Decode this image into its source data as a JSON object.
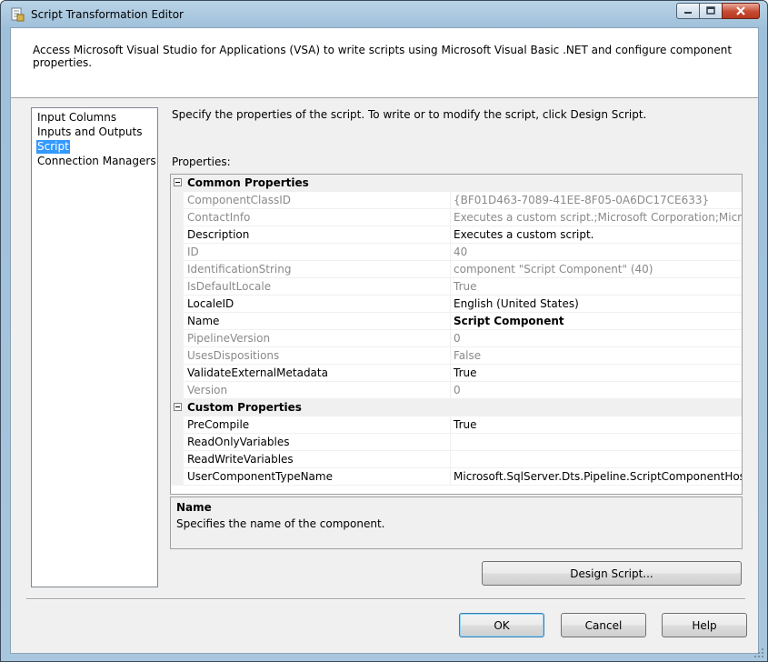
{
  "window": {
    "title": "Script Transformation Editor",
    "icon": "script-editor-icon"
  },
  "header": {
    "description": "Access Microsoft Visual Studio for Applications (VSA) to write scripts using Microsoft Visual Basic .NET and configure component properties."
  },
  "nav": {
    "items": [
      {
        "label": "Input Columns",
        "selected": false
      },
      {
        "label": "Inputs and Outputs",
        "selected": false
      },
      {
        "label": "Script",
        "selected": true
      },
      {
        "label": "Connection Managers",
        "selected": false
      }
    ]
  },
  "main": {
    "instruction": "Specify the properties of the script. To write or to modify the script, click Design Script.",
    "properties_label": "Properties:"
  },
  "grid": {
    "categories": [
      {
        "label": "Common Properties",
        "rows": [
          {
            "name": "ComponentClassID",
            "value": "{BF01D463-7089-41EE-8F05-0A6DC17CE633}",
            "enabled": false
          },
          {
            "name": "ContactInfo",
            "value": "Executes a custom script.;Microsoft Corporation;Microsoft Sc",
            "enabled": false
          },
          {
            "name": "Description",
            "value": "Executes a custom script.",
            "enabled": true
          },
          {
            "name": "ID",
            "value": "40",
            "enabled": false
          },
          {
            "name": "IdentificationString",
            "value": "component \"Script Component\" (40)",
            "enabled": false
          },
          {
            "name": "IsDefaultLocale",
            "value": "True",
            "enabled": false
          },
          {
            "name": "LocaleID",
            "value": "English (United States)",
            "enabled": true
          },
          {
            "name": "Name",
            "value": "Script Component",
            "enabled": true,
            "bold": true
          },
          {
            "name": "PipelineVersion",
            "value": "0",
            "enabled": false
          },
          {
            "name": "UsesDispositions",
            "value": "False",
            "enabled": false
          },
          {
            "name": "ValidateExternalMetadata",
            "value": "True",
            "enabled": true
          },
          {
            "name": "Version",
            "value": "0",
            "enabled": false
          }
        ]
      },
      {
        "label": "Custom Properties",
        "rows": [
          {
            "name": "PreCompile",
            "value": "True",
            "enabled": true
          },
          {
            "name": "ReadOnlyVariables",
            "value": "",
            "enabled": true
          },
          {
            "name": "ReadWriteVariables",
            "value": "",
            "enabled": true
          },
          {
            "name": "UserComponentTypeName",
            "value": "Microsoft.SqlServer.Dts.Pipeline.ScriptComponentHost, Micr",
            "enabled": true
          }
        ]
      }
    ]
  },
  "help": {
    "title": "Name",
    "description": "Specifies the name of the component."
  },
  "buttons": {
    "design_script": "Design Script...",
    "ok": "OK",
    "cancel": "Cancel",
    "help": "Help"
  }
}
